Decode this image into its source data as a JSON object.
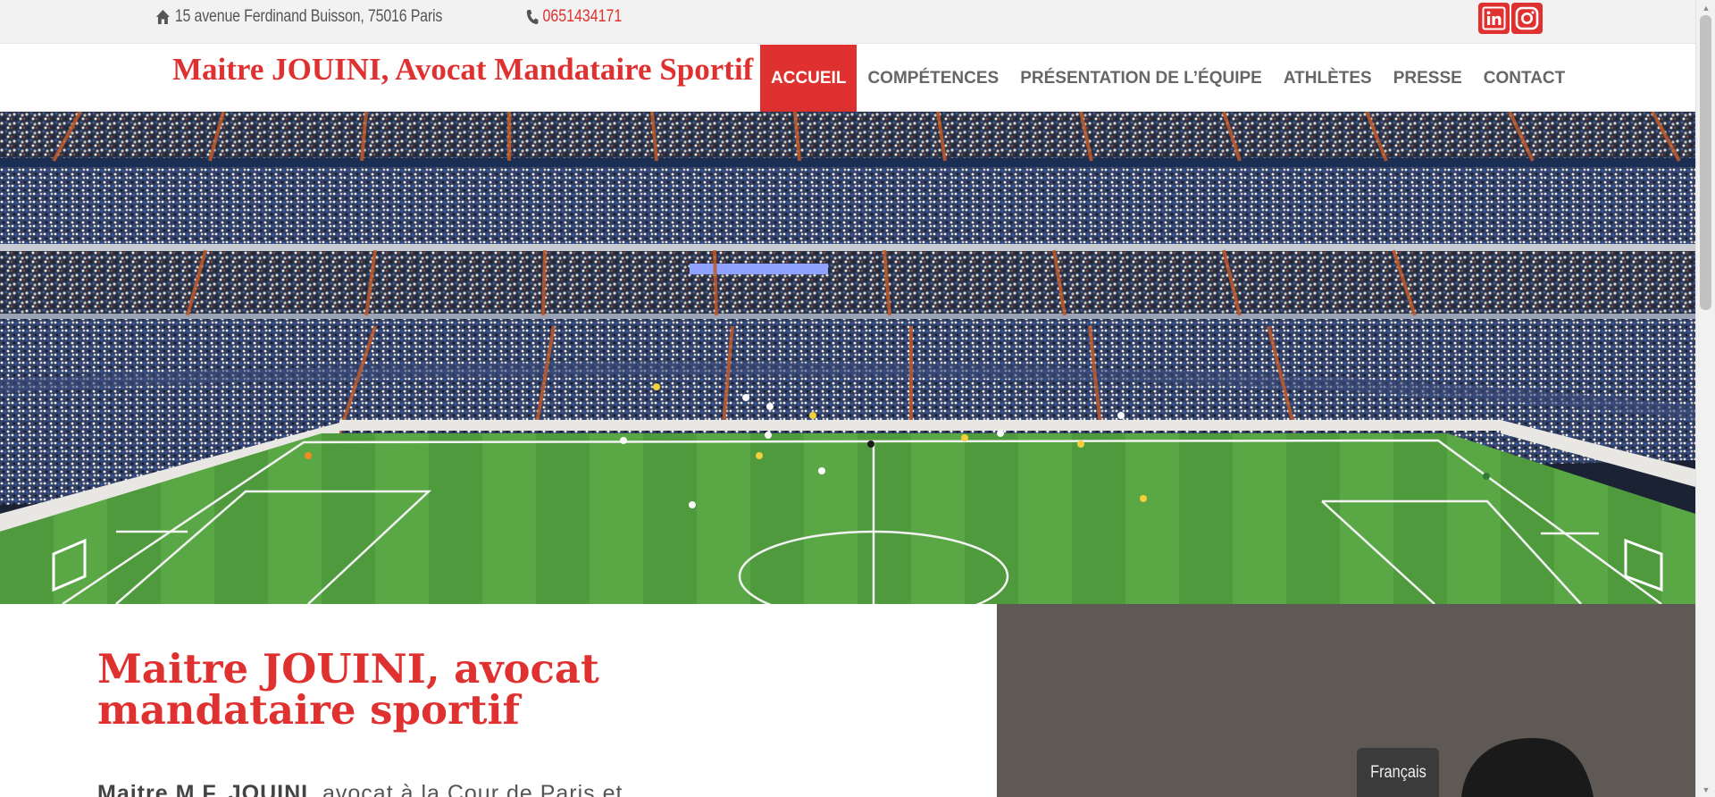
{
  "topbar": {
    "address_icon": "home-icon",
    "address": "15 avenue Ferdinand Buisson, 75016 Paris",
    "phone_icon": "phone-icon",
    "phone": "0651434171",
    "social": [
      {
        "name": "linkedin-icon",
        "label": "in"
      },
      {
        "name": "instagram-icon"
      }
    ]
  },
  "header": {
    "brand": "Maitre JOUINI, Avocat Mandataire Sportif",
    "nav": [
      "ACCUEIL",
      "COMPÉTENCES",
      "PRÉSENTATION DE L’ÉQUIPE",
      "ATHLÈTES",
      "PRESSE",
      "CONTACT"
    ],
    "active_nav": "ACCUEIL"
  },
  "hero": {
    "image": "football-stadium-photo"
  },
  "main": {
    "title": "Maitre JOUINI, avocat mandataire sportif",
    "intro_name": "Maitre M.F. JOUINI",
    "intro_text": ", avocat à la Cour de Paris et"
  },
  "language": {
    "current": "Français"
  },
  "colors": {
    "accent": "#e03131",
    "topbar_bg": "#f2f2f2",
    "nav_text": "#666666"
  }
}
